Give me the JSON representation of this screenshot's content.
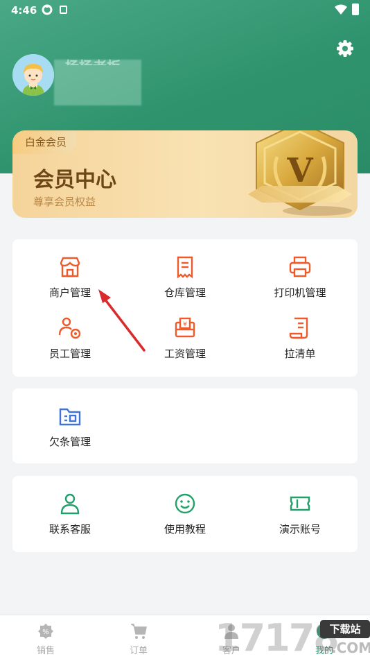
{
  "status_bar": {
    "time": "4:46"
  },
  "profile": {
    "username": "杨杨老板"
  },
  "vip": {
    "tag": "白金会员",
    "title": "会员中心",
    "subtitle": "尊享会员权益",
    "badge_letter": "V"
  },
  "menu_main": [
    {
      "label": "商户管理",
      "icon": "storefront-icon"
    },
    {
      "label": "仓库管理",
      "icon": "receipt-icon"
    },
    {
      "label": "打印机管理",
      "icon": "printer-icon"
    },
    {
      "label": "员工管理",
      "icon": "staff-settings-icon"
    },
    {
      "label": "工资管理",
      "icon": "wage-icon"
    },
    {
      "label": "拉清单",
      "icon": "list-document-icon"
    }
  ],
  "menu_debt": [
    {
      "label": "欠条管理",
      "icon": "folder-icon"
    }
  ],
  "menu_help": [
    {
      "label": "联系客服",
      "icon": "person-icon"
    },
    {
      "label": "使用教程",
      "icon": "smile-icon"
    },
    {
      "label": "演示账号",
      "icon": "ticket-icon"
    }
  ],
  "tabs": [
    {
      "label": "销售",
      "icon": "sales-icon"
    },
    {
      "label": "订单",
      "icon": "cart-icon"
    },
    {
      "label": "客户",
      "icon": "customer-icon"
    },
    {
      "label": "我的",
      "icon": "me-icon"
    }
  ],
  "watermark": {
    "number": "17178",
    "tag": "下载站",
    "domain": ".COM"
  },
  "colors": {
    "header": "#2f946e",
    "accent_orange": "#ef5a2a",
    "accent_blue": "#3f74d6",
    "accent_green": "#22a06a",
    "gold": "#c99a3e"
  }
}
